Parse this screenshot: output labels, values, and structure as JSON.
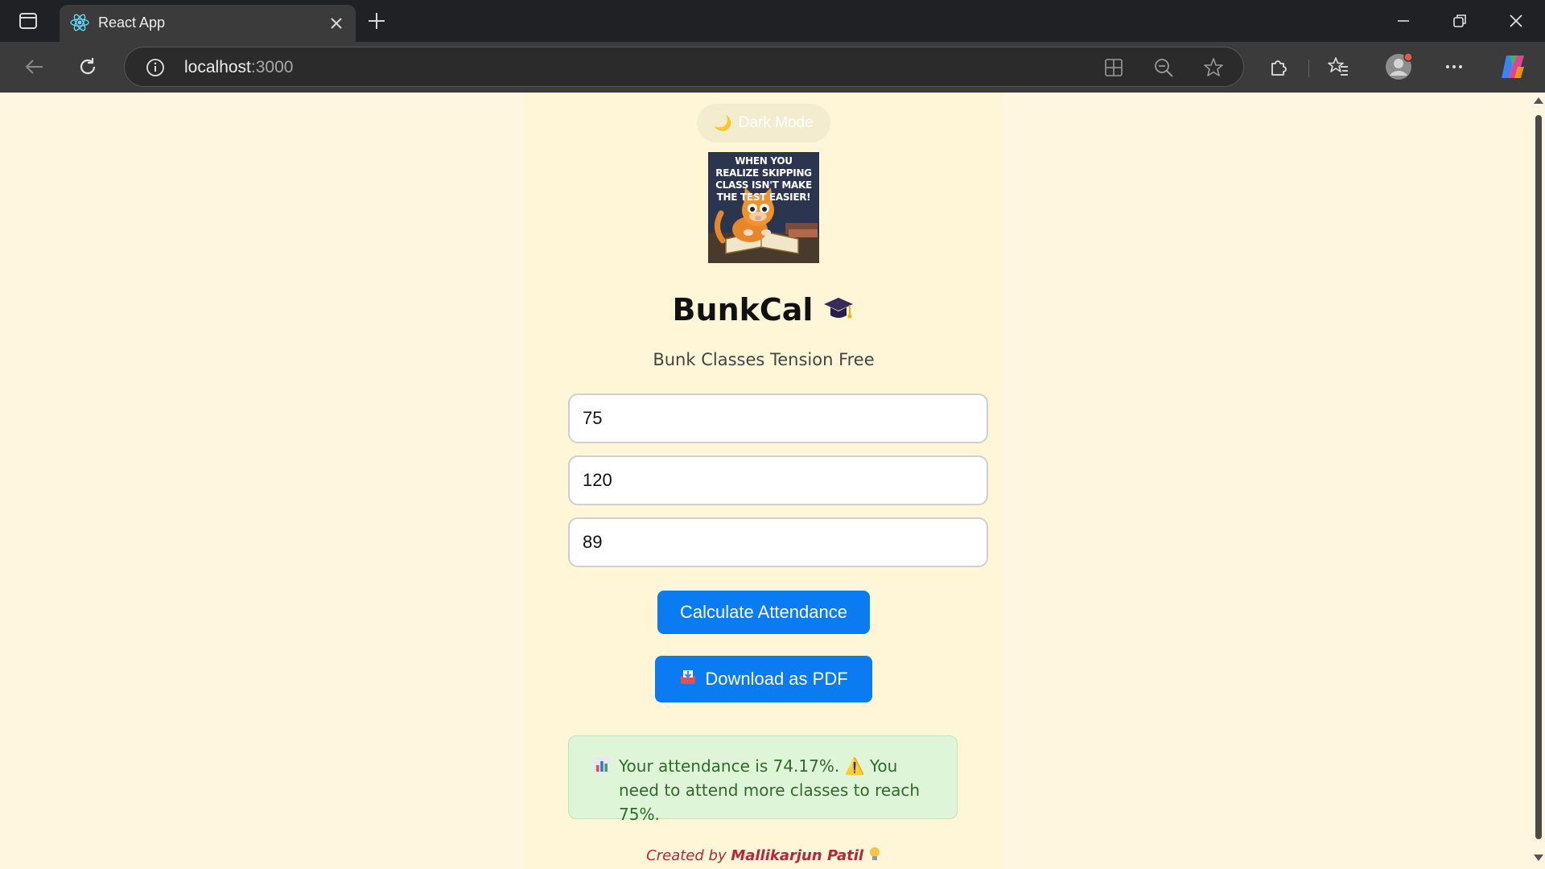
{
  "browser": {
    "tab_title": "React App",
    "url_host": "localhost",
    "url_port": ":3000"
  },
  "page": {
    "dark_mode_label": "Dark Mode",
    "meme_text": "WHEN YOU REALIZE SKIPPING CLASS ISN'T MAKE THE TEST EASIER!",
    "title": "BunkCal",
    "tagline": "Bunk Classes Tension Free",
    "inputs": {
      "required_percentage": "75",
      "total_classes": "120",
      "attended_classes": "89"
    },
    "calculate_label": "Calculate Attendance",
    "download_label": "Download as PDF",
    "result_text": "Your attendance is 74.17%. ⚠️ You need to attend more classes to reach 75%.",
    "footer_prefix": "Created by ",
    "footer_author": "Mallikarjun Patil"
  },
  "colors": {
    "page_background": "#fef6de",
    "button_blue": "#0a7bf0",
    "result_background": "#dff5d8",
    "result_text": "#2e6b2a",
    "footer_text": "#b5273a"
  },
  "icons": {
    "tab_favicon": "react-icon",
    "dark_mode": "moon-icon",
    "title": "graduation-cap-icon",
    "download": "inbox-tray-icon",
    "result": "bar-chart-icon",
    "footer": "lightbulb-icon"
  }
}
